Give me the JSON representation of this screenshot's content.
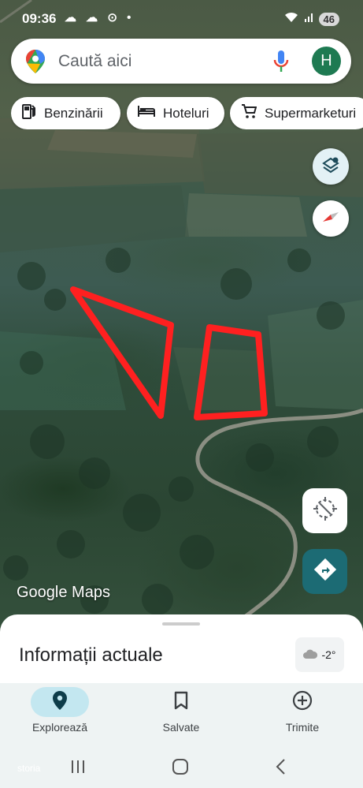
{
  "status_bar": {
    "time": "09:36",
    "battery": "46"
  },
  "search": {
    "placeholder": "Caută aici",
    "avatar_initial": "H"
  },
  "chips": [
    {
      "label": "Benzinării",
      "icon": "gas-station-icon"
    },
    {
      "label": "Hoteluri",
      "icon": "bed-icon"
    },
    {
      "label": "Supermarketuri",
      "icon": "cart-icon"
    }
  ],
  "map": {
    "logo": "Google Maps",
    "annotation_color": "#ff2020"
  },
  "sheet": {
    "title": "Informații actuale",
    "temperature": "-2°"
  },
  "nav": {
    "items": [
      {
        "label": "Explorează",
        "icon": "location-pin-icon",
        "active": true
      },
      {
        "label": "Salvate",
        "icon": "bookmark-icon",
        "active": false
      },
      {
        "label": "Trimite",
        "icon": "add-circle-icon",
        "active": false
      }
    ]
  },
  "system": {
    "watermark": "storia"
  }
}
